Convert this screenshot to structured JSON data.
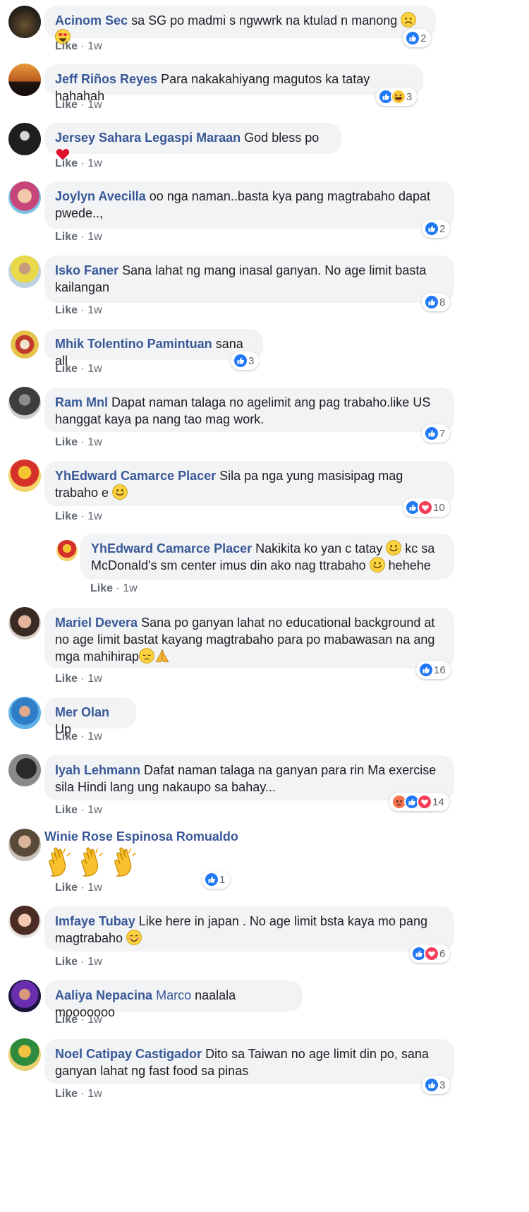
{
  "colors": {
    "name": "#385898",
    "like_blue": "#2078f4",
    "love_red": "#f33e58",
    "bubble": "#f2f3f5"
  },
  "like_label": "Like",
  "dot": "·",
  "comments": [
    {
      "name": "Acinom Sec",
      "text": "sa SG po madmi s ngwwrk na ktulad n manong",
      "emojis": [
        "worried-face-emoji",
        "heart-eyes-emoji"
      ],
      "time": "1w",
      "reactions": [
        "like"
      ],
      "count": "2"
    },
    {
      "name": "Jeff Riños Reyes",
      "text": "Para nakakahiyang magutos ka tatay hahahah",
      "time": "1w",
      "reactions": [
        "like",
        "haha"
      ],
      "count": "3"
    },
    {
      "name": "Jersey Sahara Legaspi Maraan",
      "text": "God bless po",
      "emojis": [
        "red-heart-emoji"
      ],
      "time": "1w"
    },
    {
      "name": "Joylyn Avecilla",
      "text": "oo nga naman..basta kya pang magtrabaho dapat pwede..,",
      "time": "1w",
      "reactions": [
        "like"
      ],
      "count": "2"
    },
    {
      "name": "Isko Faner",
      "text": "Sana lahat ng mang inasal ganyan. No age limit basta kailangan",
      "time": "1w",
      "reactions": [
        "like"
      ],
      "count": "8"
    },
    {
      "name": "Mhik Tolentino Pamintuan",
      "text": "sana all",
      "time": "1w",
      "reactions": [
        "like"
      ],
      "count": "3"
    },
    {
      "name": "Ram Mnl",
      "text": "Dapat naman talaga no agelimit ang pag trabaho.like US hanggat kaya pa nang tao mag work.",
      "time": "1w",
      "reactions": [
        "like"
      ],
      "count": "7"
    },
    {
      "name": "YhEdward Camarce Placer",
      "text": "Sila pa nga yung masisipag mag trabaho e",
      "emojis": [
        "smile-emoji"
      ],
      "time": "1w",
      "reactions": [
        "like",
        "love"
      ],
      "count": "10"
    },
    {
      "name": "YhEdward Camarce Placer",
      "text_parts": [
        "Nakikita ko yan c tatay",
        "kc sa McDonald's sm center imus din ako nag ttrabaho",
        "hehehe"
      ],
      "time": "1w",
      "reply": true
    },
    {
      "name": "Mariel Devera",
      "text": "Sana po ganyan lahat no educational background at no age limit bastat kayang magtrabaho para po mabawasan na ang mga mahihirap",
      "emojis": [
        "pensive-emoji",
        "folded-hands-emoji"
      ],
      "time": "1w",
      "reactions": [
        "like"
      ],
      "count": "16"
    },
    {
      "name": "Mer Olan",
      "text": "Up",
      "time": "1w"
    },
    {
      "name": "Iyah Lehmann",
      "text": "Dafat naman talaga na ganyan para rin Ma exercise sila Hindi lang ung nakaupo sa bahay...",
      "time": "1w",
      "reactions": [
        "angry",
        "like",
        "love"
      ],
      "count": "14"
    },
    {
      "name": "Winie Rose Espinosa Romualdo",
      "emojis": [
        "clapping-hands-emoji",
        "clapping-hands-emoji",
        "clapping-hands-emoji"
      ],
      "time": "1w",
      "reactions": [
        "like"
      ],
      "count": "1"
    },
    {
      "name": "Imfaye Tubay",
      "text": "Like here in japan . No age limit bsta kaya mo pang magtrabaho",
      "emojis": [
        "blush-emoji"
      ],
      "time": "1w",
      "reactions": [
        "like",
        "love"
      ],
      "count": "6"
    },
    {
      "name": "Aaliya Nepacina",
      "tag": "Marco",
      "text": "naalala mooooooo",
      "time": "1w"
    },
    {
      "name": "Noel Catipay Castigador",
      "text": "Dito sa Taiwan no age limit din po, sana ganyan lahat ng fast food sa pinas",
      "time": "1w",
      "reactions": [
        "like"
      ],
      "count": "3"
    }
  ]
}
